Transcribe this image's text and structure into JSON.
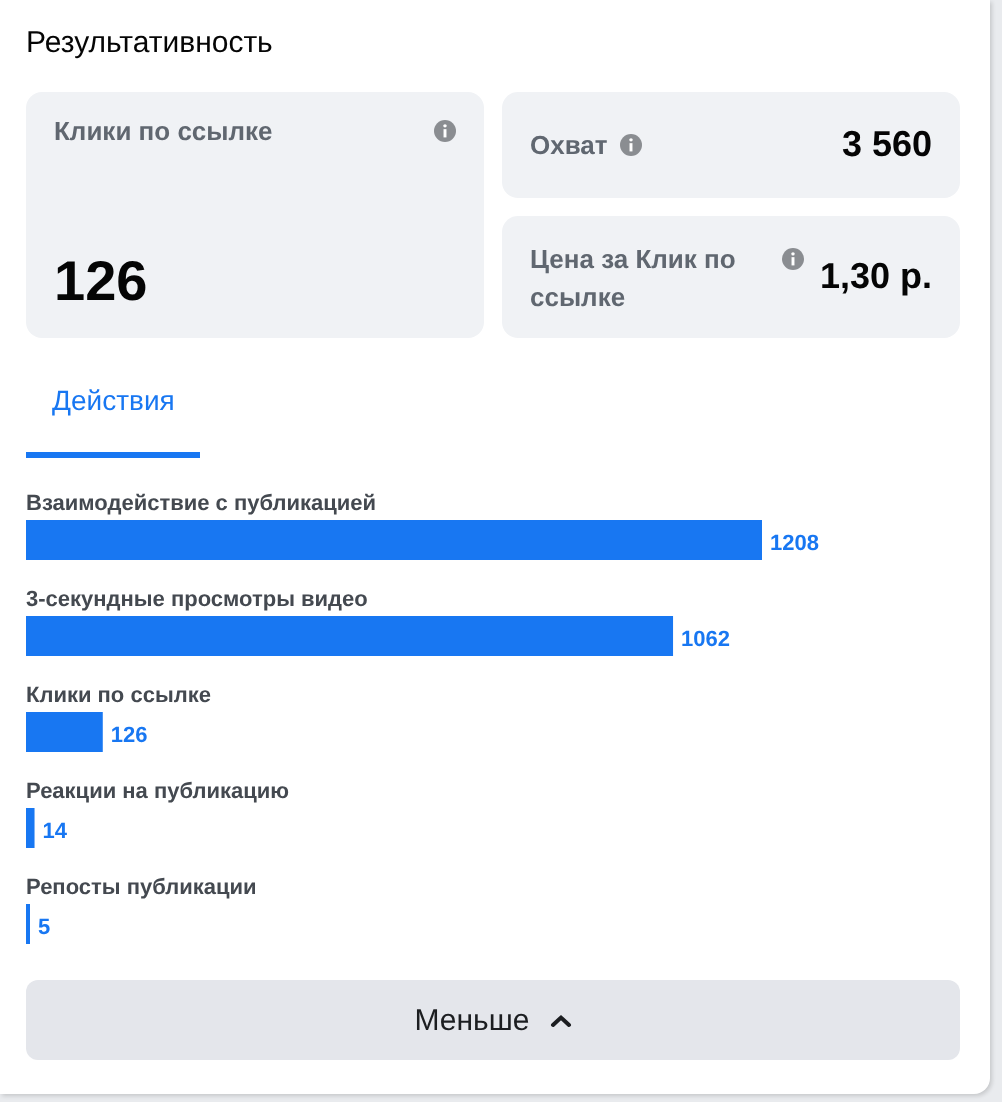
{
  "title": "Результативность",
  "metrics": {
    "main": {
      "label": "Клики по ссылке",
      "value": "126"
    },
    "side": [
      {
        "label": "Охват",
        "value": "3 560"
      },
      {
        "label": "Цена за Клик по ссылке",
        "value": "1,30 р."
      }
    ]
  },
  "tabs": [
    {
      "label": "Действия",
      "selected": true
    }
  ],
  "chart_data": {
    "type": "bar",
    "orientation": "horizontal",
    "categories": [
      "Взаимодействие с публикацией",
      "3-секундные просмотры видео",
      "Клики по ссылке",
      "Реакции на публикацию",
      "Репосты публикации"
    ],
    "values": [
      1208,
      1062,
      126,
      14,
      5
    ],
    "data_labels": true
  },
  "toggle_button": {
    "label": "Меньше"
  }
}
